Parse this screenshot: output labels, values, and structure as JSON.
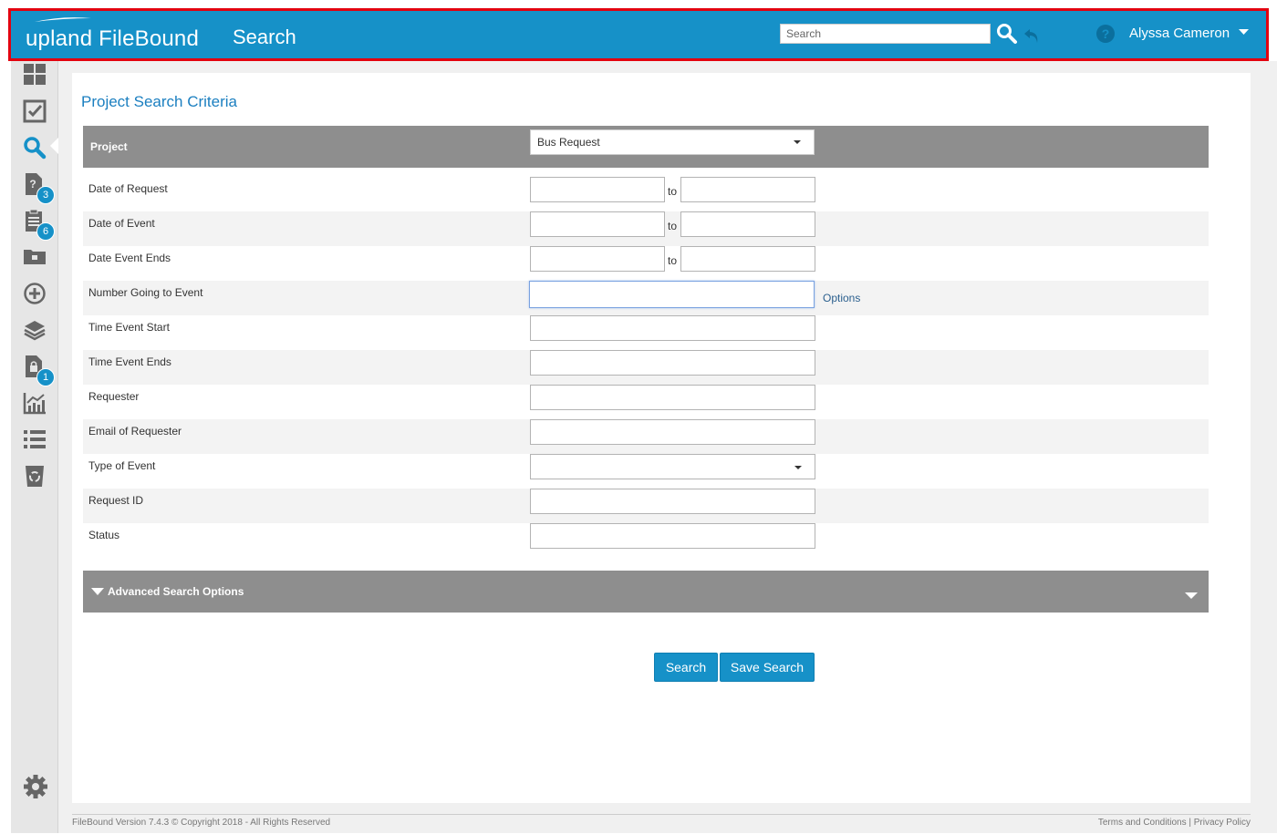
{
  "header": {
    "logo_word1": "upland",
    "logo_word2": "FileBound",
    "page_title": "Search",
    "search_placeholder": "Search",
    "user_name": "Alyssa Cameron"
  },
  "sidebar": {
    "items": [
      {
        "name": "dashboard",
        "icon": "dashboard-grid-icon"
      },
      {
        "name": "tasks",
        "icon": "checkbox-icon"
      },
      {
        "name": "search",
        "icon": "search-icon",
        "active": true
      },
      {
        "name": "questions",
        "icon": "document-question-icon",
        "badge": "3"
      },
      {
        "name": "clipboard",
        "icon": "clipboard-icon",
        "badge": "6"
      },
      {
        "name": "folders",
        "icon": "folder-icon"
      },
      {
        "name": "add",
        "icon": "add-circle-icon"
      },
      {
        "name": "layers",
        "icon": "layers-icon"
      },
      {
        "name": "locked-docs",
        "icon": "locked-document-icon",
        "badge": "1"
      },
      {
        "name": "reports",
        "icon": "chart-icon"
      },
      {
        "name": "lists",
        "icon": "list-icon"
      },
      {
        "name": "recycle",
        "icon": "recycle-bin-icon"
      },
      {
        "name": "settings",
        "icon": "gear-icon"
      }
    ]
  },
  "main": {
    "title": "Project Search Criteria",
    "project_label": "Project",
    "project_value": "Bus Request",
    "to_label": "to",
    "options_label": "Options",
    "fields": [
      {
        "label": "Date of Request",
        "type": "range"
      },
      {
        "label": "Date of Event",
        "type": "range"
      },
      {
        "label": "Date Event Ends",
        "type": "range"
      },
      {
        "label": "Number Going to Event",
        "type": "text-options"
      },
      {
        "label": "Time Event Start",
        "type": "text"
      },
      {
        "label": "Time Event Ends",
        "type": "text"
      },
      {
        "label": "Requester",
        "type": "text"
      },
      {
        "label": "Email of Requester",
        "type": "text"
      },
      {
        "label": "Type of Event",
        "type": "select"
      },
      {
        "label": "Request ID",
        "type": "text"
      },
      {
        "label": "Status",
        "type": "text"
      }
    ],
    "advanced_label": "Advanced Search Options",
    "search_button": "Search",
    "save_search_button": "Save Search"
  },
  "footer": {
    "copyright": "FileBound Version 7.4.3 © Copyright 2018 - All Rights Reserved",
    "terms": "Terms and Conditions",
    "separator": "|",
    "privacy": "Privacy Policy"
  },
  "colors": {
    "brand_blue": "#1691c8",
    "highlight_red": "#e3000f",
    "section_gray": "#8e8e8e",
    "title_blue": "#1b7fc0"
  }
}
